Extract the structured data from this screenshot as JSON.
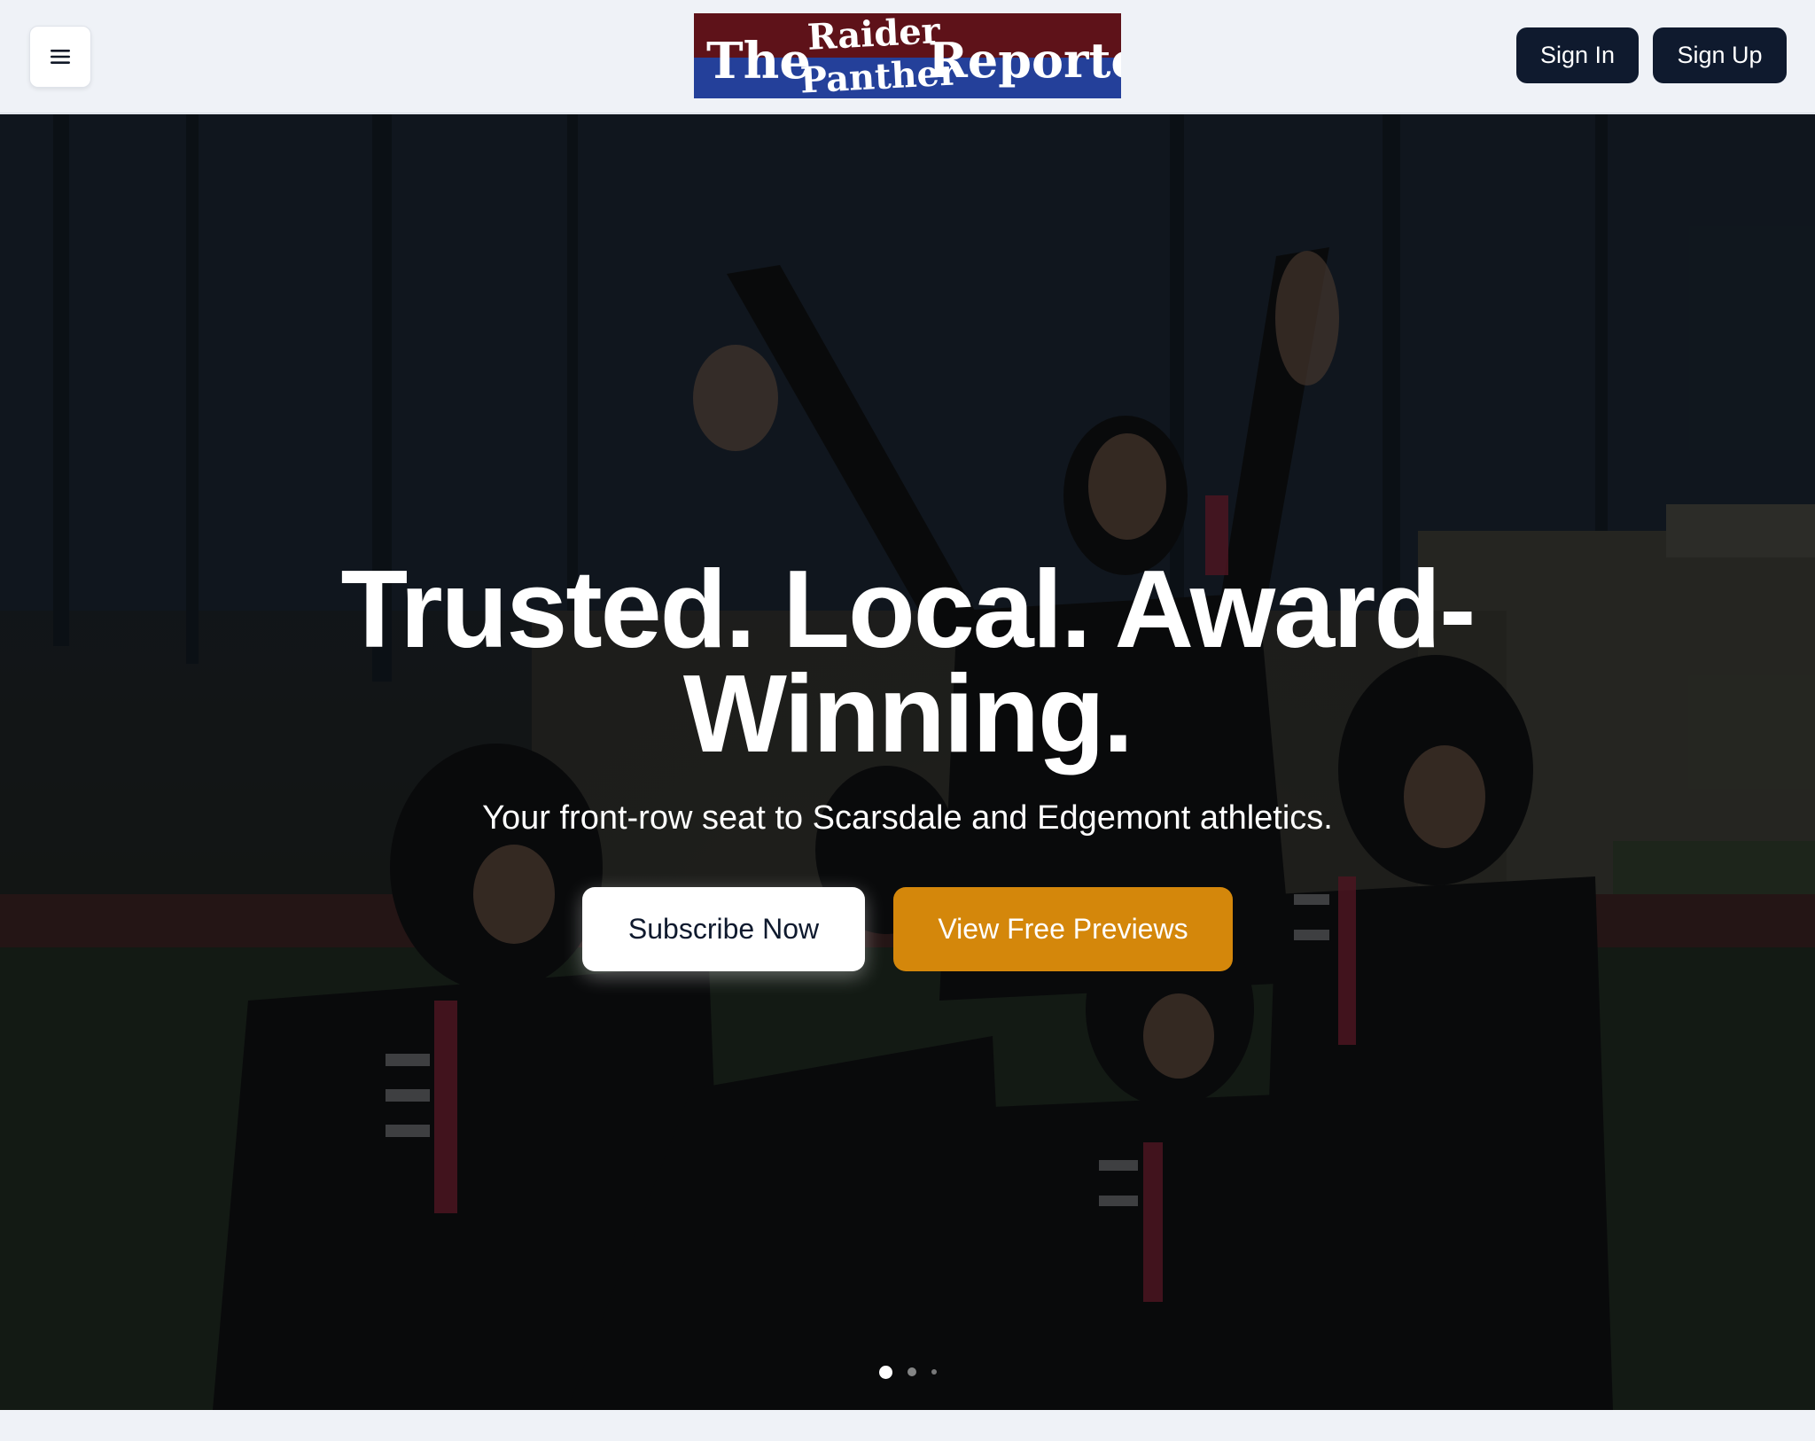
{
  "header": {
    "logo": {
      "word_the": "The",
      "word_raider": "Raider",
      "word_panther": "Panther",
      "word_reporter": "Reporter",
      "color_top": "#5e1219",
      "color_bottom": "#24409a"
    },
    "menu_icon": "hamburger-menu-icon",
    "sign_in_label": "Sign In",
    "sign_up_label": "Sign Up"
  },
  "hero": {
    "headline_line1": "Trusted. Local. Award-",
    "headline_line2": "Winning.",
    "subheadline": "Your front-row seat to Scarsdale and Edgemont athletics.",
    "subscribe_label": "Subscribe Now",
    "previews_label": "View Free Previews",
    "slides_total": 3,
    "active_slide": 1,
    "image_description_icon": "hero-photo"
  },
  "colors": {
    "accent": "#d4870b",
    "dark_button": "#0f1a2e",
    "page_bg": "#eff2f7"
  }
}
